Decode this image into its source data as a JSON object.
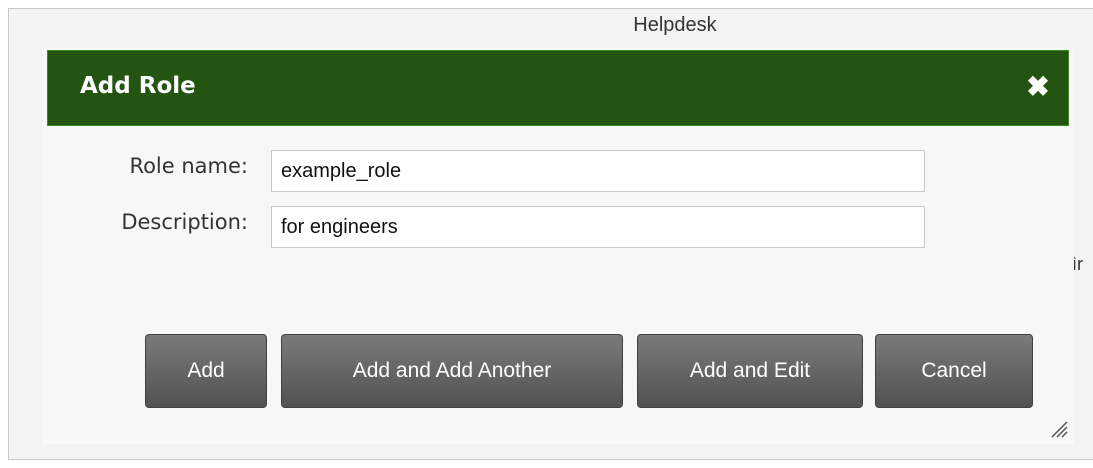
{
  "background": {
    "title": "Helpdesk",
    "partial_text": "ìr"
  },
  "dialog": {
    "title": "Add Role",
    "close_icon": "close-icon",
    "fields": {
      "role_name": {
        "label": "Role name:",
        "value": "example_role"
      },
      "description": {
        "label": "Description:",
        "value": "for engineers"
      }
    },
    "buttons": {
      "add": "Add",
      "add_another": "Add and Add Another",
      "add_edit": "Add and Edit",
      "cancel": "Cancel"
    }
  },
  "colors": {
    "header_bg": "#235411",
    "button_bg": "#626262"
  }
}
